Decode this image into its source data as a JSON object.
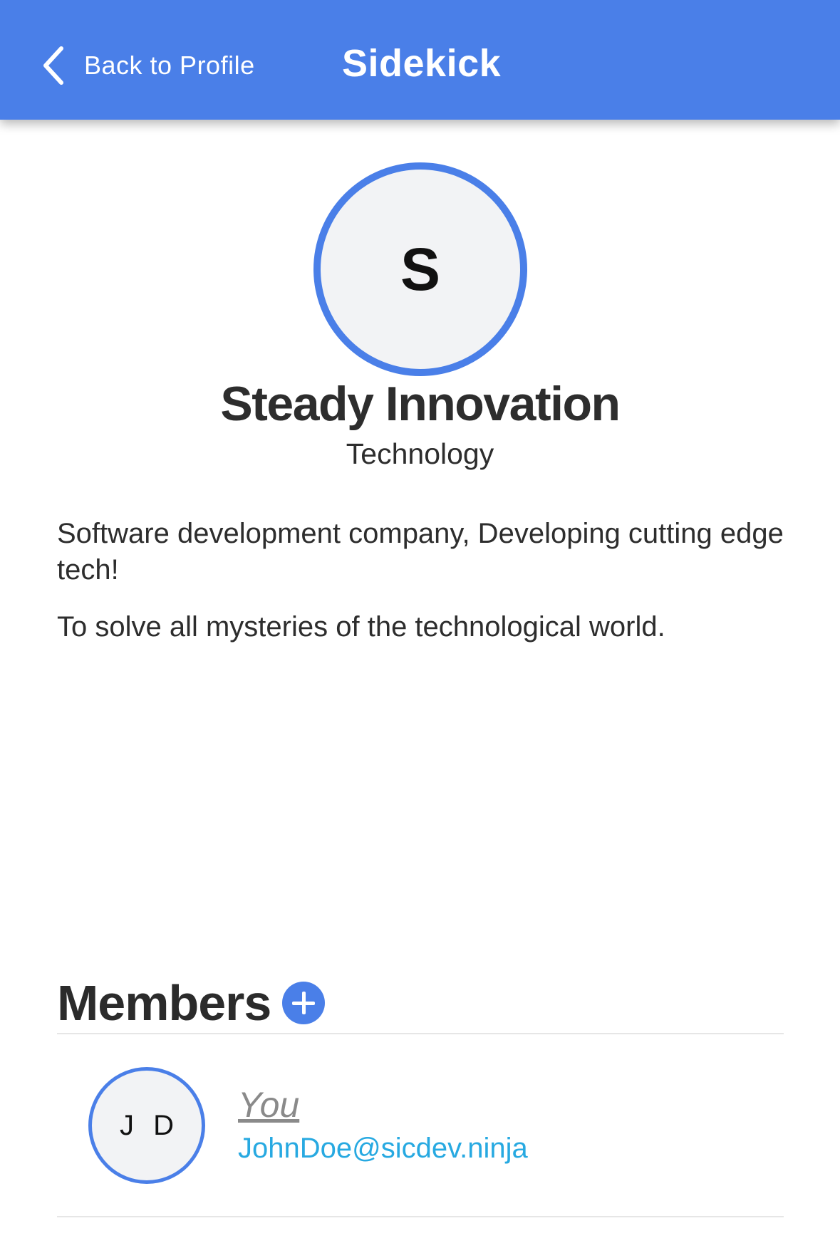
{
  "header": {
    "back_label": "Back to Profile",
    "title": "Sidekick",
    "back_icon": "chevron-left-icon"
  },
  "organization": {
    "avatar_letter": "S",
    "name": "Steady Innovation",
    "category": "Technology",
    "description": "Software development company, Developing cutting edge tech!",
    "mission": "To solve all mysteries of the technological world."
  },
  "members": {
    "title": "Members",
    "add_icon": "plus-circle-icon",
    "items": [
      {
        "initials": "J D",
        "name": "You",
        "email": "JohnDoe@sicdev.ninja"
      }
    ]
  },
  "colors": {
    "accent": "#4a7fe8",
    "email_link": "#27a9e1",
    "text": "#2d2d2d",
    "avatar_bg": "#f2f3f5"
  }
}
